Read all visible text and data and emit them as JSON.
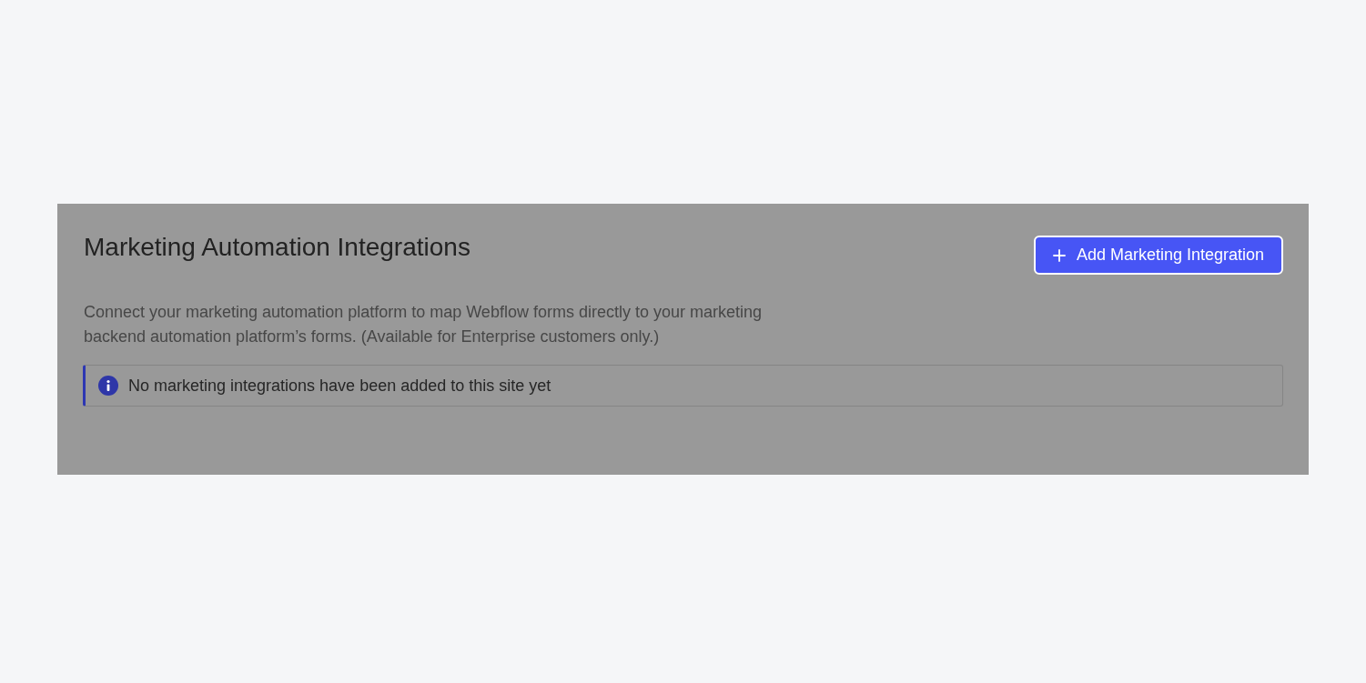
{
  "panel": {
    "title": "Marketing Automation Integrations",
    "add_button": {
      "label": "Add Marketing Integration"
    },
    "description": "Connect your marketing automation platform to map Webflow forms directly to your marketing backend automation platform’s forms. (Available for Enterprise customers only.)",
    "notice": {
      "text": "No marketing integrations have been added to this site yet"
    }
  }
}
